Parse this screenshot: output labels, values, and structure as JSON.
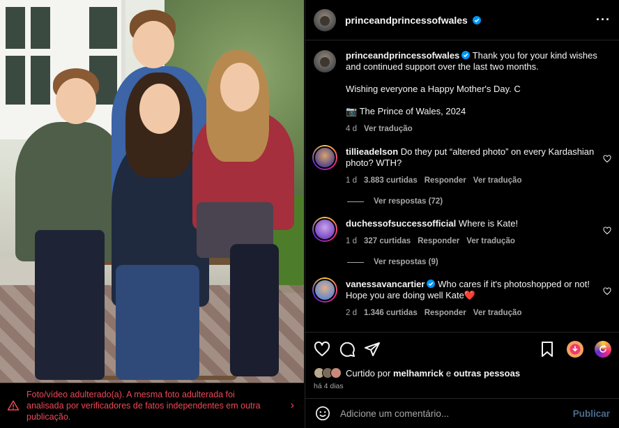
{
  "post": {
    "author": "princeandprincessofwales",
    "more_icon": "more-horizontal-icon"
  },
  "alert": {
    "text": "Foto/vídeo adulterado(a). A mesma foto adulterada foi analisada por verificadores de fatos independentes em outra publicação.",
    "color": "#ed4956"
  },
  "caption": {
    "author": "princeandprincessofwales",
    "line1": "Thank you for your kind wishes and continued support over the last two months.",
    "line2": "Wishing everyone a Happy Mother's Day. C",
    "line3": "📷 The Prince of Wales, 2024",
    "time": "4 d",
    "translate": "Ver tradução"
  },
  "comments": [
    {
      "author": "tillieadelson",
      "text": "Do they put “altered photo” on every Kardashian photo? WTH?",
      "time": "1 d",
      "likes": "3.883 curtidas",
      "reply": "Responder",
      "translate": "Ver tradução",
      "replies": "Ver respostas (72)"
    },
    {
      "author": "duchessofsuccessofficial",
      "text": "Where is Kate!",
      "time": "1 d",
      "likes": "327 curtidas",
      "reply": "Responder",
      "translate": "Ver tradução",
      "replies": "Ver respostas (9)"
    },
    {
      "author": "vanessavancartier",
      "text": "Who cares if it's photoshopped or not! Hope you are doing well Kate",
      "emoji": "❤️",
      "time": "2 d",
      "likes": "1.346 curtidas",
      "reply": "Responder",
      "translate": "Ver tradução"
    }
  ],
  "likes_line": {
    "prefix": "Curtido por",
    "user": "melhamrick",
    "conj": "e",
    "others": "outras pessoas"
  },
  "posted_ago": "há 4 dias",
  "comment_box": {
    "placeholder": "Adicione um comentário...",
    "publish": "Publicar"
  },
  "colors": {
    "background": "#000000",
    "text": "#f5f5f5",
    "muted": "#a8a8a8",
    "verified": "#0095f6",
    "publish_disabled": "#4c6c8d"
  }
}
